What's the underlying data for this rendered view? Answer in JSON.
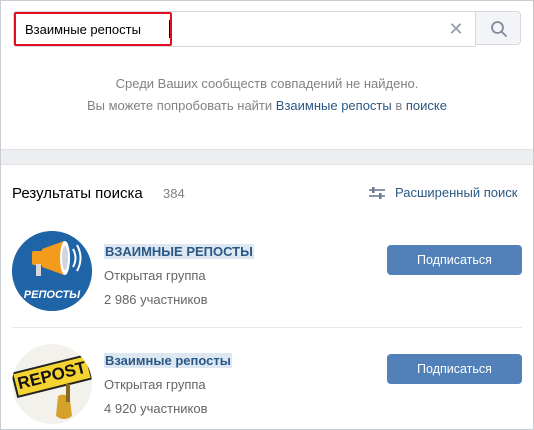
{
  "search": {
    "value": "Взаимные репосты",
    "clear": "✕"
  },
  "notfound": {
    "line1": "Среди Ваших сообществ совпадений не найдено.",
    "line2_prefix": "Вы можете попробовать найти",
    "line2_link": "Взаимные репосты",
    "line2_middle": "в",
    "line2_link2": "поиске"
  },
  "results": {
    "title": "Результаты поиска",
    "count": "384",
    "advanced_search": "Расширенный поиск",
    "items": [
      {
        "name": "ВЗАИМНЫЕ РЕПОСТЫ",
        "type": "Открытая группа",
        "members": "2 986 участников",
        "button": "Подписаться",
        "avatar_text": "РЕПОСТЫ"
      },
      {
        "name": "Взаимные репосты",
        "type": "Открытая группа",
        "members": "4 920 участников",
        "button": "Подписаться",
        "avatar_text": "REPOST"
      }
    ]
  },
  "colors": {
    "link": "#2a5885",
    "button": "#5181b8",
    "highlight_border": "#e00e1f"
  }
}
